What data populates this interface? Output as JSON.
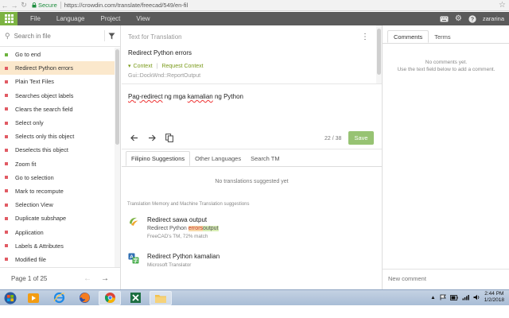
{
  "browser": {
    "secure_label": "Secure",
    "url": "https://crowdin.com/translate/freecad/549/en-fil"
  },
  "app_bar": {
    "menu": [
      "File",
      "Language",
      "Project",
      "View"
    ],
    "username": "zararina"
  },
  "left_panel": {
    "search_placeholder": "Search in file",
    "items": [
      {
        "label": "Go to end",
        "status": "green",
        "active": false
      },
      {
        "label": "Redirect Python errors",
        "status": "red",
        "active": true
      },
      {
        "label": "Plain Text Files",
        "status": "red",
        "active": false
      },
      {
        "label": "Searches object labels",
        "status": "red",
        "active": false
      },
      {
        "label": "Clears the search field",
        "status": "red",
        "active": false
      },
      {
        "label": "Select only",
        "status": "red",
        "active": false
      },
      {
        "label": "Selects only this object",
        "status": "red",
        "active": false
      },
      {
        "label": "Deselects this object",
        "status": "red",
        "active": false
      },
      {
        "label": "Zoom fit",
        "status": "red",
        "active": false
      },
      {
        "label": "Go to selection",
        "status": "red",
        "active": false
      },
      {
        "label": "Mark to recompute",
        "status": "red",
        "active": false
      },
      {
        "label": "Selection View",
        "status": "red",
        "active": false
      },
      {
        "label": "Duplicate subshape",
        "status": "red",
        "active": false
      },
      {
        "label": "Application",
        "status": "red",
        "active": false
      },
      {
        "label": "Labels & Attributes",
        "status": "red",
        "active": false
      },
      {
        "label": "Modified file",
        "status": "red",
        "active": false
      }
    ],
    "pager": "Page 1 of 25"
  },
  "source": {
    "header": "Text for Translation",
    "text": "Redirect Python errors",
    "context_label": "Context",
    "request_context_label": "Request Context",
    "key": "Gui::DockWnd::ReportOutput"
  },
  "translation": {
    "word1": "Pag-redirect",
    "rest": " ng mga ",
    "word2": "kamalian",
    "rest2": " ng Python",
    "char_count": "22 / 38",
    "save_label": "Save"
  },
  "suggestion_tabs": [
    "Filipino Suggestions",
    "Other Languages",
    "Search TM"
  ],
  "no_suggestions": "No translations suggested yet",
  "tm_header": "Translation Memory and Machine Translation suggestions",
  "suggestions": [
    {
      "title": "Redirect sawa output",
      "line_prefix": "Redirect Python ",
      "line_removed": "errors",
      "line_added": "output",
      "meta": "FreeCAD's TM, 72% match"
    },
    {
      "title": "Redirect Python kamalian",
      "meta": "Microsoft Translator"
    }
  ],
  "right_panel": {
    "tabs": [
      "Comments",
      "Terms"
    ],
    "no_comments_line1": "No comments yet.",
    "no_comments_line2": "Use the text field below to add a comment.",
    "new_comment_placeholder": "New comment"
  },
  "taskbar": {
    "time": "2:44 PM",
    "date": "1/2/2018"
  },
  "colors": {
    "accent_green": "#7cb342",
    "save_button": "#97c373",
    "active_row": "#fbe8cc",
    "status_red": "#e15b64",
    "status_green": "#6cb33e"
  }
}
